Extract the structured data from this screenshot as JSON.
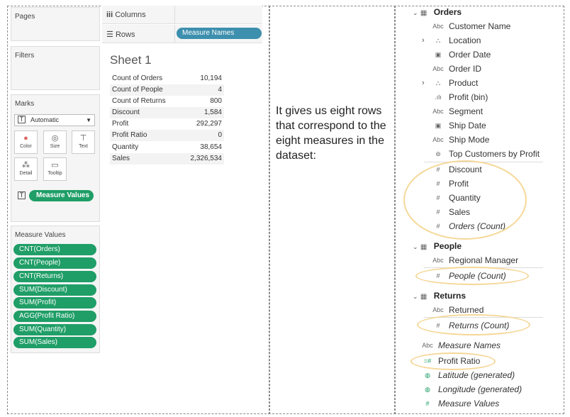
{
  "left_panel": {
    "pages": "Pages",
    "filters": "Filters",
    "marks": "Marks",
    "marks_type": "Automatic",
    "mark_cards": [
      {
        "label": "Color",
        "icon": "color-icon"
      },
      {
        "label": "Size",
        "icon": "size-icon"
      },
      {
        "label": "Text",
        "icon": "text-icon"
      },
      {
        "label": "Detail",
        "icon": "detail-icon"
      },
      {
        "label": "Tooltip",
        "icon": "tooltip-icon"
      }
    ],
    "measure_values_pill": "Measure Values",
    "measure_values_title": "Measure Values",
    "measure_values": [
      "CNT(Orders)",
      "CNT(People)",
      "CNT(Returns)",
      "SUM(Discount)",
      "SUM(Profit)",
      "AGG(Profit Ratio)",
      "SUM(Quantity)",
      "SUM(Sales)"
    ]
  },
  "shelves": {
    "columns": "Columns",
    "rows": "Rows",
    "rows_pill": "Measure Names"
  },
  "sheet": {
    "title": "Sheet 1",
    "rows": [
      [
        "Count of Orders",
        "10,194"
      ],
      [
        "Count of People",
        "4"
      ],
      [
        "Count of Returns",
        "800"
      ],
      [
        "Discount",
        "1,584"
      ],
      [
        "Profit",
        "292,297"
      ],
      [
        "Profit Ratio",
        "0"
      ],
      [
        "Quantity",
        "38,654"
      ],
      [
        "Sales",
        "2,326,534"
      ]
    ]
  },
  "caption": "It gives us eight rows that correspond to the eight measures in the dataset:",
  "data_pane": {
    "orders": {
      "title": "Orders",
      "items": [
        {
          "icon": "Abc",
          "label": "Customer Name"
        },
        {
          "icon": "hier",
          "label": "Location"
        },
        {
          "icon": "cal",
          "label": "Order Date"
        },
        {
          "icon": "Abc",
          "label": "Order ID"
        },
        {
          "icon": "hier",
          "label": "Product"
        },
        {
          "icon": "bin",
          "label": "Profit (bin)"
        },
        {
          "icon": "Abc",
          "label": "Segment"
        },
        {
          "icon": "cal",
          "label": "Ship Date"
        },
        {
          "icon": "Abc",
          "label": "Ship Mode"
        },
        {
          "icon": "set",
          "label": "Top Customers by Profit"
        },
        {
          "icon": "#",
          "label": "Discount"
        },
        {
          "icon": "#",
          "label": "Profit"
        },
        {
          "icon": "#",
          "label": "Quantity"
        },
        {
          "icon": "#",
          "label": "Sales"
        },
        {
          "icon": "#",
          "label": "Orders (Count)"
        }
      ]
    },
    "people": {
      "title": "People",
      "items": [
        {
          "icon": "Abc",
          "label": "Regional Manager"
        },
        {
          "icon": "#",
          "label": "People (Count)"
        }
      ]
    },
    "returns": {
      "title": "Returns",
      "items": [
        {
          "icon": "Abc",
          "label": "Returned"
        },
        {
          "icon": "#",
          "label": "Returns (Count)"
        }
      ]
    },
    "bottom": [
      {
        "icon": "Abc",
        "label": "Measure Names"
      },
      {
        "icon": "=#",
        "label": "Profit Ratio"
      },
      {
        "icon": "globe",
        "label": "Latitude (generated)"
      },
      {
        "icon": "globe",
        "label": "Longitude (generated)"
      },
      {
        "icon": "#",
        "label": "Measure Values"
      }
    ]
  },
  "colors": {
    "measure_pill": "#1f9e67",
    "rows_pill": "#3d8fae",
    "highlight": "#f5d898"
  }
}
